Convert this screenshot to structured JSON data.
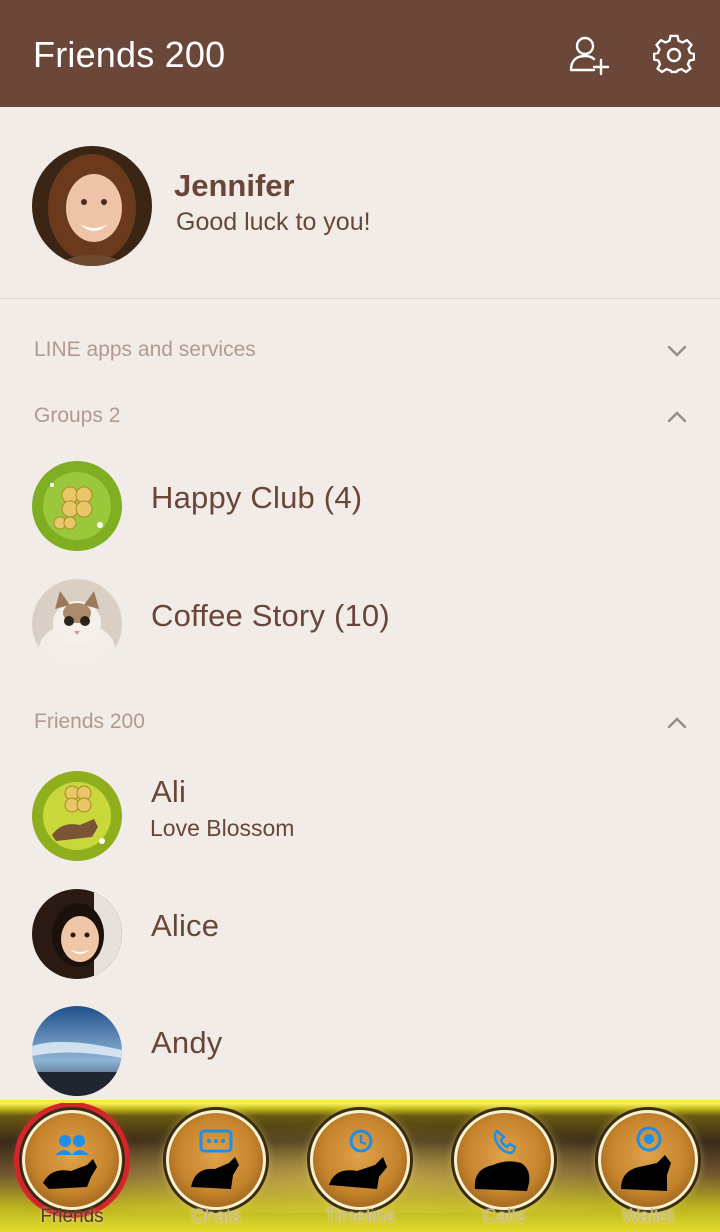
{
  "header": {
    "title": "Friends 200",
    "add_friend_icon": "add-friend-icon",
    "settings_icon": "gear-icon"
  },
  "profile": {
    "name": "Jennifer",
    "status": "Good luck to you!"
  },
  "sections": {
    "services": {
      "label": "LINE apps and services",
      "state": "collapsed"
    },
    "groups": {
      "label": "Groups 2",
      "state": "expanded"
    },
    "friends": {
      "label": "Friends 200",
      "state": "expanded"
    }
  },
  "groups": [
    {
      "name": "Happy Club (4)"
    },
    {
      "name": "Coffee Story (10)"
    }
  ],
  "friends": [
    {
      "name": "Ali",
      "status": "Love Blossom"
    },
    {
      "name": "Alice",
      "status": ""
    },
    {
      "name": "Andy",
      "status": ""
    }
  ],
  "tabs": [
    {
      "label": "Friends",
      "icon": "friends-icon",
      "active": true
    },
    {
      "label": "Chats",
      "icon": "chat-icon",
      "active": false
    },
    {
      "label": "Timeline",
      "icon": "clock-icon",
      "active": false
    },
    {
      "label": "Calls",
      "icon": "phone-icon",
      "active": false
    },
    {
      "label": "Wallet",
      "icon": "wallet-icon",
      "active": false
    }
  ],
  "colors": {
    "header_bg": "#6a4739",
    "page_bg": "#f1ece7",
    "text_brown": "#6a4638",
    "section_label": "#b09a90",
    "tab_accent": "#d4242c",
    "tab_icon_blue": "#1e8ee8"
  }
}
